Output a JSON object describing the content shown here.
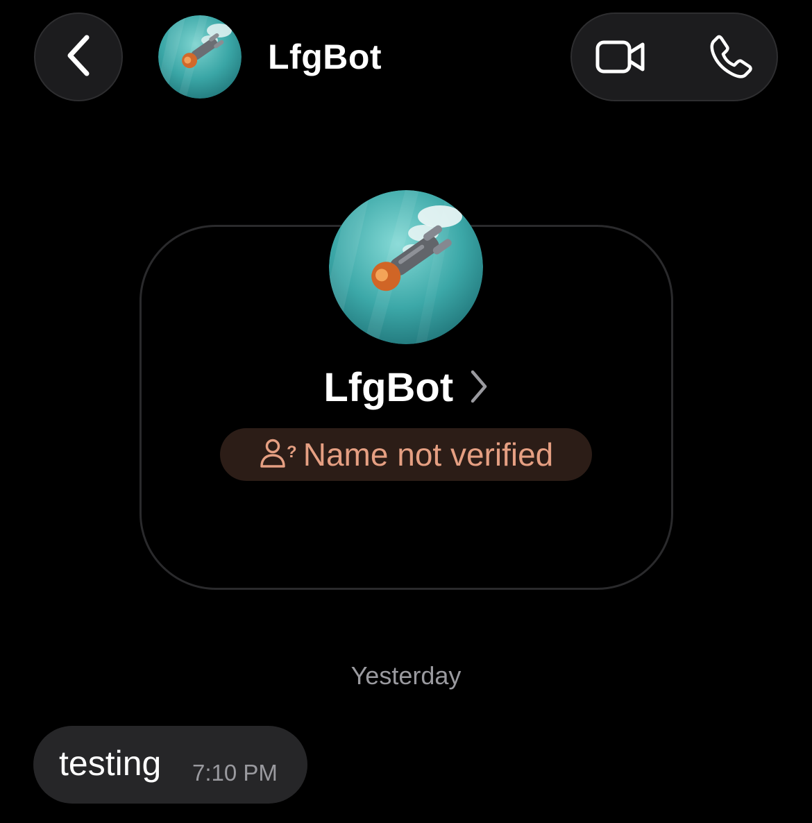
{
  "header": {
    "back_icon": "chevron-left-icon",
    "contact_name": "LfgBot",
    "video_icon": "video-camera-icon",
    "phone_icon": "phone-icon"
  },
  "profile": {
    "name": "LfgBot",
    "chevron_icon": "chevron-right-icon",
    "verification_icon": "person-question-icon",
    "verification_status": "Name not verified",
    "verification_color": "#e59f82"
  },
  "conversation": {
    "date_separator": "Yesterday",
    "messages": [
      {
        "text": "testing",
        "time": "7:10 PM",
        "direction": "incoming"
      }
    ]
  },
  "colors": {
    "background": "#000000",
    "control_surface": "#1c1c1e",
    "bubble": "#262628",
    "secondary_text": "#9a9a9f"
  }
}
